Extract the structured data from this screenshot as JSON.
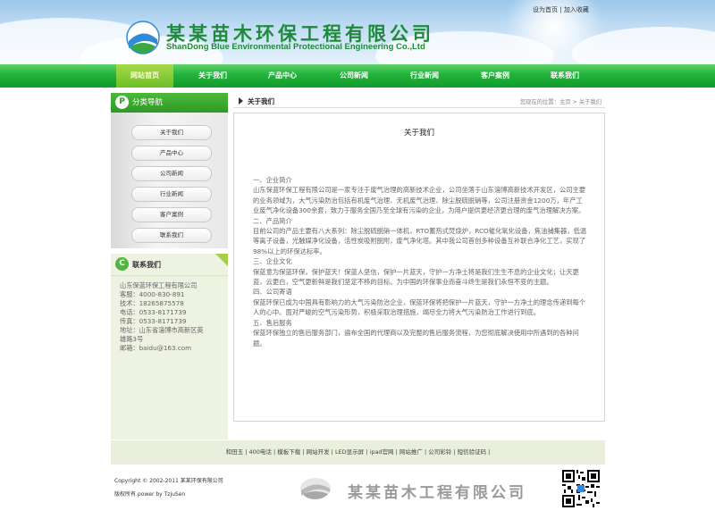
{
  "header": {
    "brand_cn": "某某苗木环保工程有限公司",
    "brand_en": "ShanDong Blue Environmental Protectional Engineering Co.,Ltd",
    "top_links": [
      "设为首页",
      "加入收藏"
    ],
    "top_sep": "|",
    "colors": {
      "brand": "#1f8a3b",
      "sky": "#9cc7ec"
    }
  },
  "nav": {
    "items": [
      "网站首页",
      "关于我们",
      "产品中心",
      "公司新闻",
      "行业新闻",
      "客户案例",
      "联系我们"
    ],
    "active_index": 0
  },
  "sidebar": {
    "nav_badge": "P",
    "nav_title": "分类导航",
    "menu": [
      "关于我们",
      "产品中心",
      "公司新闻",
      "行业新闻",
      "客户案例",
      "联系我们"
    ],
    "contact_badge": "C",
    "contact_title": "联系我们",
    "contact_lines": [
      "山东保蓝环保工程有限公司",
      "客服：4000-830-891",
      "技术：18265875578",
      "电话：0533-8171739",
      "传真：0533-8171739",
      "地址：山东省淄博市高新区英",
      "雄路3号",
      "邮箱：baidu@163.com"
    ]
  },
  "main": {
    "section_title": "关于我们",
    "breadcrumb": {
      "prefix": "您现在的位置：",
      "home": "主页",
      "sep": " > ",
      "current": "关于我们"
    },
    "page_title": "关于我们",
    "paragraphs": [
      "一、企业简介",
      "山东保蓝环保工程有限公司是一家专注于废气治理的高新技术企业，公司坐落于山东淄博高新技术开发区，公司主要的业务领域为，大气污染防治包括有机废气治理、无机废气治理、除尘脱硫脱硝等，公司注册资金1200万，年产工业废气净化设备300余套，致力于服务全国乃至全球有污染的企业，为用户提供更经济更合理的废气治理解决方案。",
      "二、产品简介",
      "目前公司的产品主要有八大系列：除尘脱硫脱硝一体机，RTO蓄热式焚烧炉，RCO催化氧化设备，焦油捕集器，低温等离子设备，光触媒净化设备，活性炭吸附脱附，废气净化塔。其中我公司首创多种设备互补联合净化工艺，实现了98%以上的环保达标率。",
      "三、企业文化",
      "保蓝意为保蓝环保，保护蓝天！保蓝人坚信，保护一片蓝天，守护一方净土将是我们生生不息的企业文化；让天更蓝，云更白，空气更新鲜是我们坚定不移的目标。为中国的环保事业而奋斗终生是我们永恒不变的主题。",
      "四、公司寄语",
      "保蓝环保已成为中国具有影响力的大气污染防治企业，保蓝环保将把保护一片蓝天，守护一方净土的理念传递到每个人的心中。面对严峻的空气污染形势，积极采取治理措施，竭尽全力将大气污染防治工作进行到底。",
      "五、售后服务",
      "保蓝环保独立的售后服务部门，遍布全国的代理商以及完整的售后服务流程，为您彻底解决使用中所遇到的各种问题。"
    ]
  },
  "footer": {
    "links": [
      "和田玉",
      "400电话",
      "模板下载",
      "网站开发",
      "LED显示屏",
      "ipad官网",
      "网站推广",
      "公司彩铃",
      "短信验证码"
    ],
    "link_sep": " |",
    "copyright": "Copyright © 2002-2011 某某环保有限公司",
    "rights": "版权所有 power by TzjuSen",
    "brand_cn": "某某苗木工程有限公司"
  }
}
